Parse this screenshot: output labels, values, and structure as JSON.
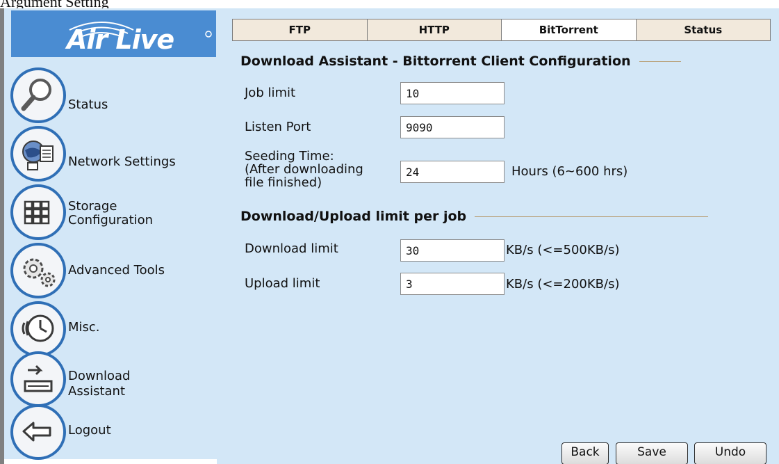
{
  "caption": "Argument Setting",
  "brand": {
    "logo_text": "Air Live"
  },
  "sidebar": {
    "items": [
      {
        "label": "Status",
        "icon": "magnifier-icon"
      },
      {
        "label": "Network Settings",
        "icon": "network-icon"
      },
      {
        "label": "Storage",
        "label2": "Configuration",
        "icon": "grid-storage-icon"
      },
      {
        "label": "Advanced Tools",
        "icon": "gears-icon"
      },
      {
        "label": "Misc.",
        "icon": "clock-icon"
      },
      {
        "label": "Download",
        "label2": "Assistant",
        "icon": "download-tray-icon"
      },
      {
        "label": "Logout",
        "icon": "back-arrow-icon"
      }
    ]
  },
  "tabs": [
    {
      "label": "FTP",
      "active": false
    },
    {
      "label": "HTTP",
      "active": false
    },
    {
      "label": "BitTorrent",
      "active": true
    },
    {
      "label": "Status",
      "active": false
    }
  ],
  "main": {
    "section1_title": "Download Assistant - Bittorrent Client Configuration",
    "job_limit": {
      "label": "Job limit",
      "value": "10"
    },
    "listen_port": {
      "label": "Listen Port",
      "value": "9090"
    },
    "seeding_time": {
      "label_line1": "Seeding Time:",
      "label_line2": "(After downloading",
      "label_line3": "file finished)",
      "value": "24",
      "hint": "Hours (6~600 hrs)"
    },
    "section2_title": "Download/Upload limit per job",
    "download_limit": {
      "label": "Download limit",
      "value": "30",
      "hint": "KB/s (<=500KB/s)"
    },
    "upload_limit": {
      "label": "Upload limit",
      "value": "3",
      "hint": "KB/s (<=200KB/s)"
    }
  },
  "buttons": {
    "back": "Back",
    "save": "Save",
    "undo": "Undo"
  },
  "colors": {
    "panel": "#d3e7f7",
    "logo_bg": "#4a8cd2",
    "tab_bg": "#f2e9dc",
    "tab_active": "#ffffff",
    "rule": "#b8a078"
  }
}
